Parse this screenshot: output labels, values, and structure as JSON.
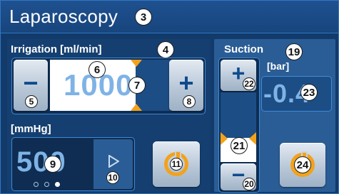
{
  "header": {
    "title": "Laparoscopy",
    "callout": "3"
  },
  "irrigation": {
    "label": "Irrigation [ml/min]",
    "label_callout": "4",
    "value": "1000",
    "value_callout": "6",
    "minus_label": "−",
    "minus_callout": "5",
    "plus_label": "+",
    "plus_callout": "8",
    "slider_callout": "7"
  },
  "pressure": {
    "label": "[mmHg]",
    "value": "500",
    "value_callout": "9",
    "next_callout": "10",
    "dots": [
      "inactive",
      "inactive",
      "active"
    ],
    "power_callout": "11"
  },
  "suction": {
    "label": "Suction",
    "label_callout": "19",
    "unit": "[bar]",
    "value": "-0.4",
    "value_callout": "23",
    "plus_label": "+",
    "plus_callout": "22",
    "minus_label": "−",
    "minus_callout": "20",
    "slider_callout": "21",
    "power_callout": "24"
  },
  "colors": {
    "background": "#123a6a",
    "accent_orange": "#f3a21a",
    "value_blue": "#7fb3e6"
  }
}
